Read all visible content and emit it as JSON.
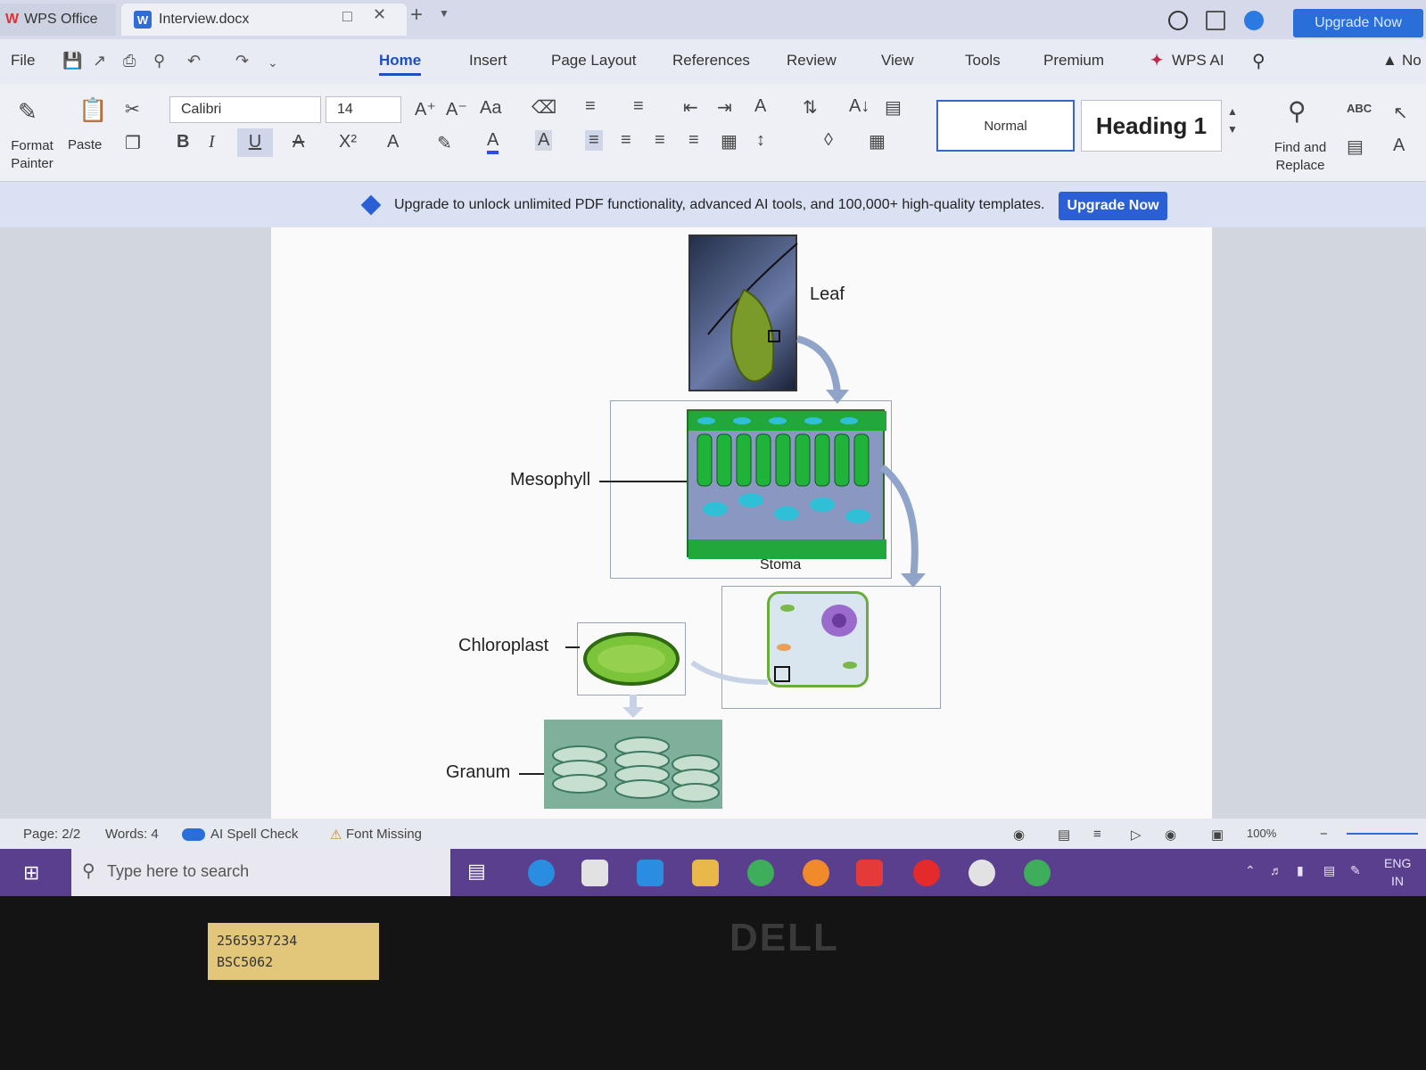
{
  "titlebar": {
    "app_tab": "WPS Office",
    "doc_tab": "Interview.docx",
    "upgrade": "Upgrade Now"
  },
  "menu": {
    "file": "File",
    "tabs": [
      "Home",
      "Insert",
      "Page Layout",
      "References",
      "Review",
      "View",
      "Tools",
      "Premium"
    ],
    "wps_ai": "WPS AI",
    "right_label": "No"
  },
  "ribbon": {
    "format_painter": "Format Painter",
    "paste": "Paste",
    "font_name": "Calibri",
    "font_size": "14",
    "style_normal": "Normal",
    "style_heading": "Heading 1",
    "find_replace": "Find and Replace"
  },
  "banner": {
    "text": "Upgrade to unlock unlimited PDF functionality, advanced AI tools, and 100,000+ high-quality templates.",
    "button": "Upgrade Now"
  },
  "diagram": {
    "leaf": "Leaf",
    "mesophyll": "Mesophyll",
    "stoma": "Stoma",
    "chloroplast": "Chloroplast",
    "granum": "Granum"
  },
  "status": {
    "page": "Page: 2/2",
    "words": "Words: 4",
    "spell": "AI Spell Check",
    "font_missing": "Font Missing",
    "zoom": "100%"
  },
  "taskbar": {
    "search_placeholder": "Type here to search",
    "lang": "ENG",
    "region": "IN"
  },
  "bezel": {
    "sticker_line1": "2565937234",
    "sticker_line2": "BSC5062",
    "brand": "DELL"
  },
  "colors": {
    "accent": "#1d4fc4",
    "taskbar": "#5a3f8f",
    "banner_button": "#2a5fd6"
  }
}
